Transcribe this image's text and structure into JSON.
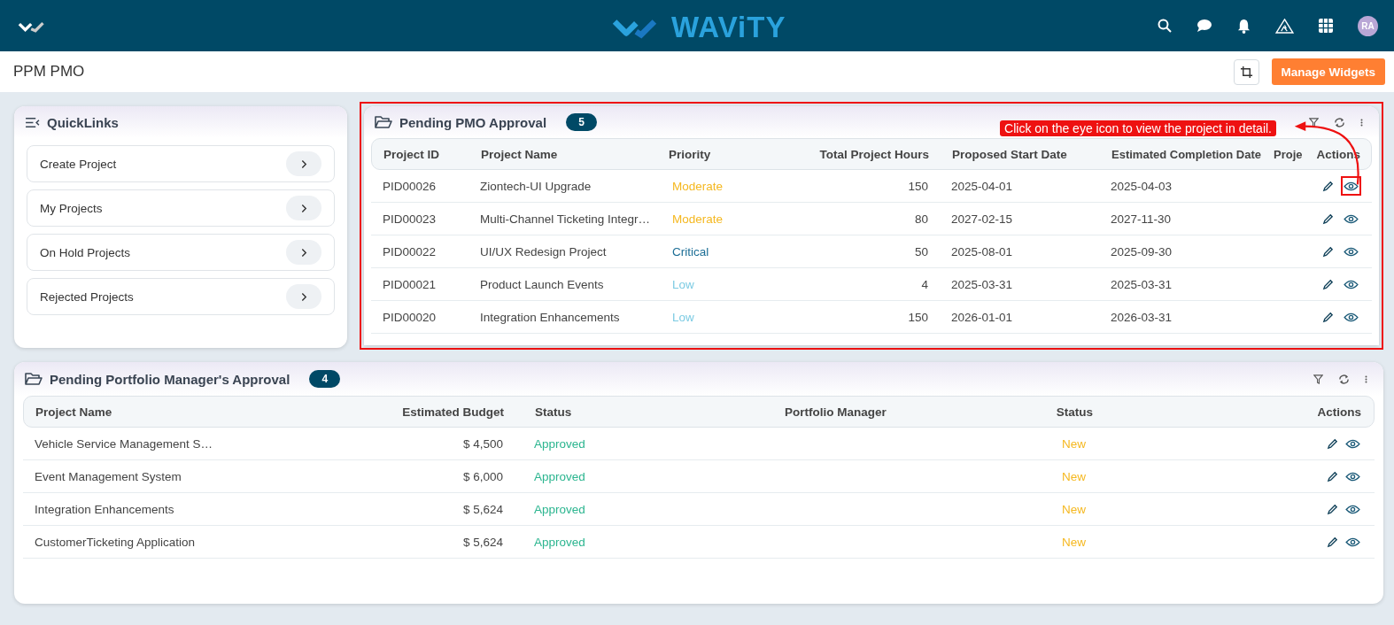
{
  "header": {
    "brand": "WAViTY",
    "avatar": "RA"
  },
  "page": {
    "title": "PPM PMO",
    "manage_button": "Manage Widgets"
  },
  "quicklinks": {
    "title": "QuickLinks",
    "items": [
      {
        "label": "Create Project"
      },
      {
        "label": "My Projects"
      },
      {
        "label": "On Hold Projects"
      },
      {
        "label": "Rejected Projects"
      }
    ]
  },
  "pmo_approval": {
    "title": "Pending PMO Approval",
    "count": "5",
    "callout": "Click on the eye icon to view the project in detail.",
    "columns": [
      "Project ID",
      "Project Name",
      "Priority",
      "Total Project Hours",
      "Proposed Start Date",
      "Estimated Completion Date",
      "Proje",
      "Actions"
    ],
    "rows": [
      {
        "id": "PID00026",
        "name": "Ziontech-UI Upgrade",
        "priority": "Moderate",
        "color": "#f5b820",
        "hours": "150",
        "start": "2025-04-01",
        "end": "2025-04-03",
        "highlighted": true
      },
      {
        "id": "PID00023",
        "name": "Multi-Channel Ticketing Integr…",
        "priority": "Moderate",
        "color": "#f5b820",
        "hours": "80",
        "start": "2027-02-15",
        "end": "2027-11-30",
        "highlighted": false
      },
      {
        "id": "PID00022",
        "name": "UI/UX Redesign Project",
        "priority": "Critical",
        "color": "#1b6d95",
        "hours": "50",
        "start": "2025-08-01",
        "end": "2025-09-30",
        "highlighted": false
      },
      {
        "id": "PID00021",
        "name": "Product Launch Events",
        "priority": "Low",
        "color": "#7ccbe3",
        "hours": "4",
        "start": "2025-03-31",
        "end": "2025-03-31",
        "highlighted": false
      },
      {
        "id": "PID00020",
        "name": "Integration Enhancements",
        "priority": "Low",
        "color": "#7ccbe3",
        "hours": "150",
        "start": "2026-01-01",
        "end": "2026-03-31",
        "highlighted": false
      }
    ]
  },
  "portfolio_approval": {
    "title": "Pending Portfolio Manager's Approval",
    "count": "4",
    "columns": [
      "Project Name",
      "Estimated Budget",
      "Status",
      "Portfolio Manager",
      "Status",
      "Actions"
    ],
    "rows": [
      {
        "name": "Vehicle Service Management S…",
        "budget": "$ 4,500",
        "status": {
          "text": "Approved",
          "color": "#2bb58f"
        },
        "pm_status": {
          "text": "New",
          "color": "#f5b820"
        }
      },
      {
        "name": "Event Management System",
        "budget": "$ 6,000",
        "status": {
          "text": "Approved",
          "color": "#2bb58f"
        },
        "pm_status": {
          "text": "New",
          "color": "#f5b820"
        }
      },
      {
        "name": "Integration Enhancements",
        "budget": "$ 5,624",
        "status": {
          "text": "Approved",
          "color": "#2bb58f"
        },
        "pm_status": {
          "text": "New",
          "color": "#f5b820"
        }
      },
      {
        "name": "CustomerTicketing Application",
        "budget": "$ 5,624",
        "status": {
          "text": "Approved",
          "color": "#2bb58f"
        },
        "pm_status": {
          "text": "New",
          "color": "#f5b820"
        }
      }
    ]
  }
}
